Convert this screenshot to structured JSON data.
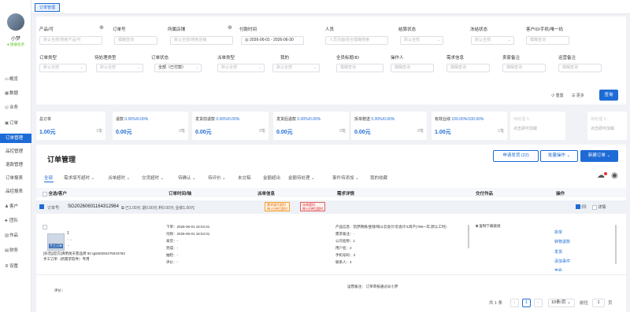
{
  "user": {
    "name": "小梦",
    "status": "接收任务"
  },
  "menu": [
    {
      "label": "概览"
    },
    {
      "label": "数据"
    },
    {
      "label": "业务"
    },
    {
      "label": "订单"
    }
  ],
  "submenu": [
    {
      "label": "订单管理"
    },
    {
      "label": "品控管理"
    },
    {
      "label": "退款管理"
    },
    {
      "label": "订单报表"
    },
    {
      "label": "品控报表"
    }
  ],
  "menu2": [
    {
      "label": "客户"
    },
    {
      "label": "团队"
    },
    {
      "label": "作品"
    },
    {
      "label": "财务"
    },
    {
      "label": "设置"
    }
  ],
  "tab": {
    "label": "订单管理"
  },
  "filters": {
    "row1": [
      {
        "label": "产品/可",
        "placeholder": "默认全部/搜索产品/可"
      },
      {
        "label": "订单号",
        "placeholder": "模糊查询"
      },
      {
        "label": "所属店铺",
        "placeholder": "默认全部/搜索店铺"
      },
      {
        "label": "付款时间",
        "value": "2026-06-01 - 2026-06-30"
      },
      {
        "label": "人员",
        "placeholder": "人员页面/姓名模糊搜索"
      },
      {
        "label": "结算状态",
        "placeholder": "默认全部"
      },
      {
        "label": "冻结状态",
        "placeholder": "默认全部"
      },
      {
        "label": "客户ID/手机/唯一码",
        "placeholder": "模糊查询"
      }
    ],
    "row2": [
      {
        "label": "订单类型",
        "placeholder": "默认全部"
      },
      {
        "label": "待处理类型",
        "placeholder": "默认全部"
      },
      {
        "label": "订单状态",
        "value": "全部（已付款）"
      },
      {
        "label": "派单类型",
        "placeholder": "默认全部"
      },
      {
        "label": "我的",
        "placeholder": "默认全部"
      },
      {
        "label": "全员标题/ID",
        "placeholder": "模糊查询"
      },
      {
        "label": "操作人",
        "placeholder": "模糊查询"
      },
      {
        "label": "需求信息",
        "placeholder": "模糊查询"
      },
      {
        "label": "卖家备注",
        "placeholder": "模糊查询"
      },
      {
        "label": "运营备注",
        "placeholder": "模糊查询"
      }
    ],
    "reset": "重置",
    "more": "更多",
    "search": "查询"
  },
  "stats": [
    {
      "label": "总订单",
      "pct": "",
      "value": "1.00元",
      "unit": "1笔"
    },
    {
      "label": "退款",
      "pct": "0.00%/0.00%",
      "value": "0.00元",
      "unit": "0笔"
    },
    {
      "label": "发货前退款",
      "pct": "0.00%/0.00%",
      "value": "0.00元",
      "unit": "0笔"
    },
    {
      "label": "发货后退款",
      "pct": "0.00%/0.00%",
      "value": "0.00元",
      "unit": "0笔"
    },
    {
      "label": "拆单赠送",
      "pct": "0.00%/0.00%",
      "value": "0.00元",
      "unit": "0笔"
    },
    {
      "label": "有效业绩",
      "pct": "100.00%/100.00%",
      "value": "1.00元",
      "unit": "1笔"
    },
    {
      "label": "待处理",
      "pct": "",
      "value": "点击即可加载",
      "unit": ""
    },
    {
      "label": "待处理",
      "pct": "",
      "value": "点击即可加载",
      "unit": ""
    }
  ],
  "main": {
    "title": "订单管理",
    "btn_apply": "申请发货 (22)",
    "btn_batch": "批量操作",
    "btn_new": "新建订单",
    "tabs": [
      "全部",
      "需求填写超时",
      "派单超时",
      "交货超时",
      "待确认",
      "待评价",
      "未交稿",
      "金额超出",
      "金额待处理",
      "事件待添加",
      "我的收藏"
    ],
    "headers": [
      "全选/客户",
      "订单时间/轴",
      "派单信息",
      "需求详情",
      "交付作品",
      "操作"
    ]
  },
  "order": {
    "label": "订单号:",
    "no": "SG20260601164312964",
    "summary": "已1.00元 退0.00元 利0.00元 业绩1.00元",
    "tag1": "需求填写超时",
    "tag1b": "每1分钟后超时",
    "tag2": "派单超时",
    "tag2b": "每1分钟后超时",
    "count": "0",
    "detail": "详情",
    "customer": "1",
    "item_title": "[抖音][官方]清明发天客品牌 ID:sg948394475043763",
    "item_sub": "手工订单（新需求软件）专用",
    "thumb": "手工订单",
    "times": [
      "下单：2026-06-01 16:04:31",
      "付款：2026-06-01 16:04:31",
      "发货：-",
      "完成：-",
      "抽检：-",
      "评价：-"
    ],
    "needs": [
      "产品信息：凯梦网络/金钱/铜斗云会计/云会计/1周产(798一年,默认工时)",
      "需求备注：-",
      "公司名称：1",
      "用户名：2",
      "手机号码：3",
      "联系人：4"
    ],
    "deliver": "复制下载链接",
    "ops": [
      "拆单",
      "转物退款",
      "发货",
      "添加事件",
      "查看"
    ],
    "foot_left": "评价：",
    "foot_ops": "运营备注：",
    "foot_ops_val": "订单审核通过@小梦"
  },
  "pager": {
    "total": "共 1 条",
    "page": "1",
    "size": "10条/页",
    "goto": "前往",
    "goto_val": "1",
    "suffix": "页"
  }
}
